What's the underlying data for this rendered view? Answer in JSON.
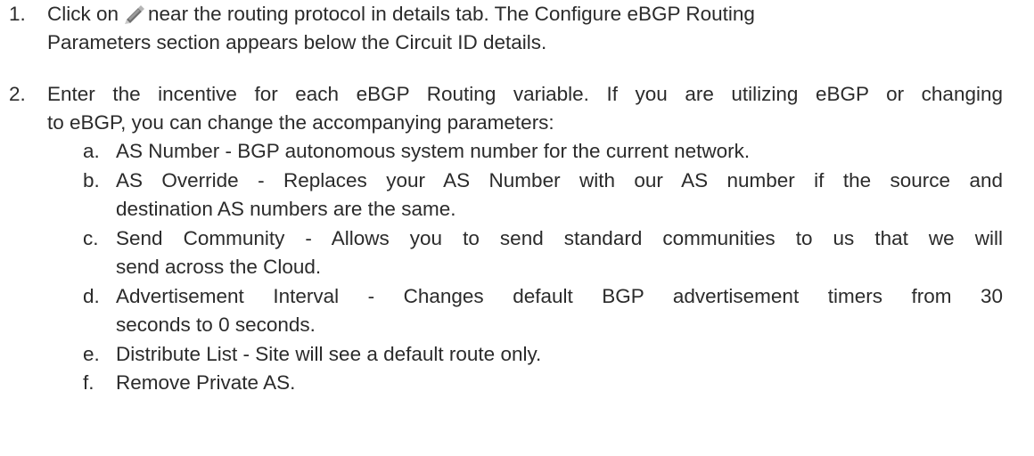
{
  "steps": [
    {
      "number": "1.",
      "text_before_icon": "Click on",
      "icon": "pencil-edit-icon",
      "text_after_icon": "near the routing protocol in details tab. The Configure eBGP Routing",
      "text_line2": "Parameters section appears below the Circuit ID details."
    },
    {
      "number": "2.",
      "text_line1": "Enter the incentive for each eBGP Routing variable. If you are utilizing eBGP or changing",
      "text_line2": "to eBGP, you can change the accompanying parameters:",
      "sub_items": [
        {
          "letter": "a.",
          "lines": [
            "AS Number - BGP autonomous system number for the current network."
          ]
        },
        {
          "letter": "b.",
          "lines": [
            "AS Override - Replaces your AS Number with our AS number if the source and",
            "destination AS numbers are the same."
          ]
        },
        {
          "letter": "c.",
          "lines": [
            "Send Community - Allows you to send standard communities to us that we will",
            "send across the Cloud."
          ]
        },
        {
          "letter": "d.",
          "lines": [
            "Advertisement Interval - Changes default BGP advertisement timers from 30",
            "seconds to 0 seconds."
          ]
        },
        {
          "letter": "e.",
          "lines": [
            "Distribute List - Site will see a default route only."
          ]
        },
        {
          "letter": "f.",
          "lines": [
            "Remove Private AS."
          ]
        }
      ]
    }
  ]
}
